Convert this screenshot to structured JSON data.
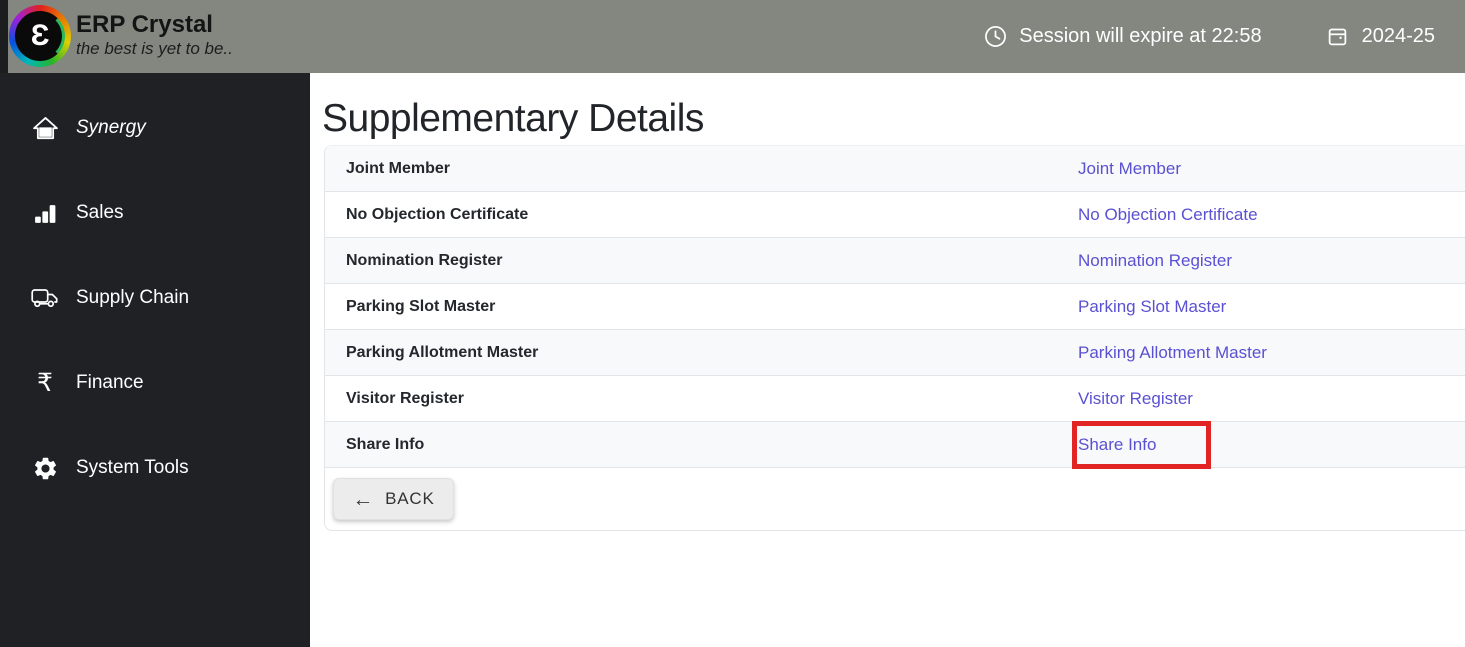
{
  "header": {
    "brand_title": "ERP Crystal",
    "brand_tagline": "the best is yet to be..",
    "session_text": "Session will expire at 22:58",
    "fiscal_year": "2024-25"
  },
  "sidebar": {
    "items": [
      {
        "label": "Synergy",
        "icon": "home-icon"
      },
      {
        "label": "Sales",
        "icon": "bar-chart-icon"
      },
      {
        "label": "Supply Chain",
        "icon": "truck-icon"
      },
      {
        "label": "Finance",
        "icon": "rupee-icon"
      },
      {
        "label": "System Tools",
        "icon": "gear-icon"
      }
    ],
    "rupee_glyph": "₹"
  },
  "main": {
    "title": "Supplementary Details",
    "rows": [
      {
        "label": "Joint Member",
        "link": "Joint Member"
      },
      {
        "label": "No Objection Certificate",
        "link": "No Objection Certificate"
      },
      {
        "label": "Nomination Register",
        "link": "Nomination Register"
      },
      {
        "label": "Parking Slot Master",
        "link": "Parking Slot Master"
      },
      {
        "label": "Parking Allotment Master",
        "link": "Parking Allotment Master"
      },
      {
        "label": "Visitor Register",
        "link": "Visitor Register"
      },
      {
        "label": "Share Info",
        "link": "Share Info",
        "highlighted": true
      }
    ],
    "back_button_label": "BACK",
    "back_arrow": "←"
  },
  "logo": {
    "glyph": "Ɛ"
  },
  "colors": {
    "header_bg": "#838780",
    "sidebar_bg": "#202125",
    "link": "#5a50d2",
    "highlight_red": "#e12424",
    "row_alt": "#f8f9fa",
    "row_border": "#e2e5e8"
  }
}
